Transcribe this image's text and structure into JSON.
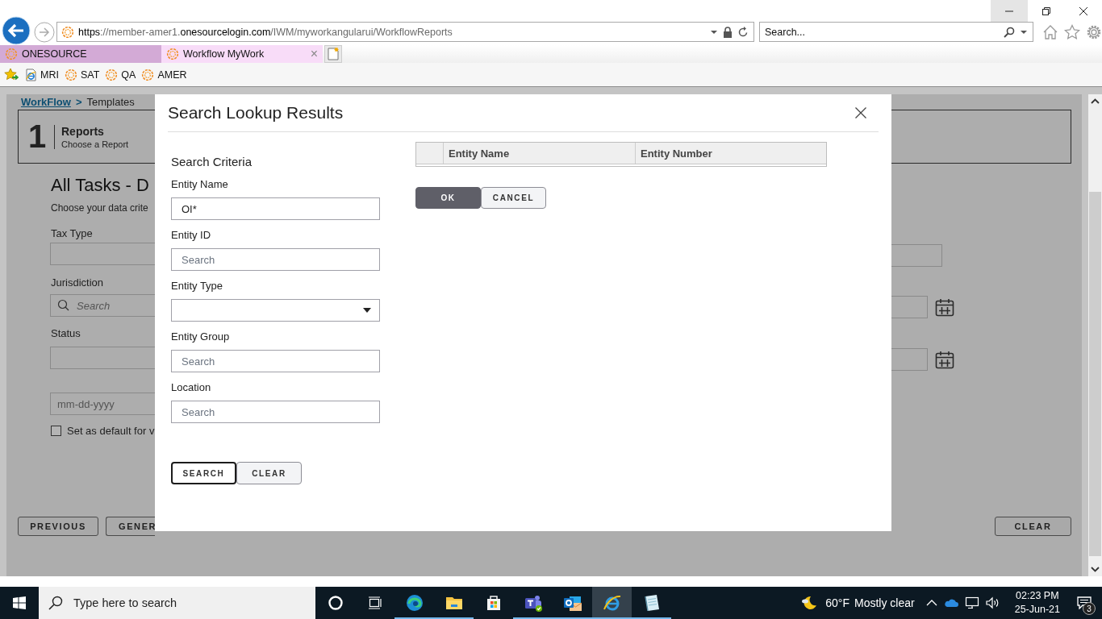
{
  "browser": {
    "url": "**https**://member-amer1.**onesourcelogin.com**/IWM/myworkangularui/WorkflowReports",
    "search_placeholder": "Search...",
    "tabs": [
      {
        "label": "ONESOURCE",
        "selected": false
      },
      {
        "label": "Workflow MyWork",
        "selected": true,
        "close": "×"
      }
    ],
    "favorites": [
      {
        "label": "MRI",
        "kind": "ie"
      },
      {
        "label": "SAT",
        "kind": "ring"
      },
      {
        "label": "QA",
        "kind": "ring"
      },
      {
        "label": "AMER",
        "kind": "ring"
      }
    ]
  },
  "page": {
    "breadcrumb": {
      "link": "WorkFlow",
      "separator": ">",
      "current": "Templates"
    },
    "step": {
      "number": "1",
      "title": "Reports",
      "subtitle": "Choose a Report"
    },
    "heading": "All Tasks - D",
    "subheading": "Choose your data crite",
    "fields": [
      {
        "label": "Tax Type",
        "kind": "text"
      },
      {
        "label": "Jurisdiction",
        "kind": "search",
        "placeholder": "Search"
      },
      {
        "label": "Status",
        "kind": "text"
      },
      {
        "kind": "text",
        "placeholder": "mm-dd-yyyy"
      }
    ],
    "default_checkbox": {
      "label": "Set as default for v",
      "checked": false
    },
    "buttons": [
      "PREVIOUS",
      "GENER"
    ],
    "right_fields": [
      {
        "kind": "text"
      },
      {
        "kind": "date"
      },
      {
        "kind": "date"
      }
    ],
    "right_button": "CLEAR"
  },
  "modal": {
    "title": "Search Lookup Results",
    "criteria_title": "Search Criteria",
    "fields": [
      {
        "label": "Entity Name",
        "kind": "text",
        "value": "OI*"
      },
      {
        "label": "Entity ID",
        "kind": "text",
        "placeholder": "Search"
      },
      {
        "label": "Entity Type",
        "kind": "select"
      },
      {
        "label": "Entity Group",
        "kind": "text",
        "placeholder": "Search"
      },
      {
        "label": "Location",
        "kind": "text",
        "placeholder": "Search"
      }
    ],
    "buttons": [
      {
        "label": "SEARCH",
        "kind": "outlined"
      },
      {
        "label": "CLEAR",
        "kind": "secondary"
      }
    ],
    "table": {
      "columns": [
        "Entity Name",
        "Entity Number"
      ]
    },
    "actions": [
      {
        "label": "OK",
        "kind": "primary"
      },
      {
        "label": "CANCEL",
        "kind": "secondary"
      }
    ]
  },
  "taskbar": {
    "search_placeholder": "Type here to search",
    "apps": [
      {
        "kind": "edge",
        "running": true,
        "selected": false
      },
      {
        "kind": "folder",
        "running": true,
        "selected": false
      },
      {
        "kind": "store",
        "running": false,
        "selected": false
      },
      {
        "kind": "teams",
        "running": true,
        "selected": false
      },
      {
        "kind": "outlook",
        "running": true,
        "selected": false
      },
      {
        "kind": "ie",
        "running": true,
        "selected": true
      },
      {
        "kind": "notes",
        "running": true,
        "selected": false
      }
    ],
    "weather": {
      "temperature": "60°F",
      "condition": "Mostly clear"
    },
    "clock": {
      "time": "02:23 PM",
      "date": "25-Jun-21"
    },
    "notifications": "3"
  }
}
